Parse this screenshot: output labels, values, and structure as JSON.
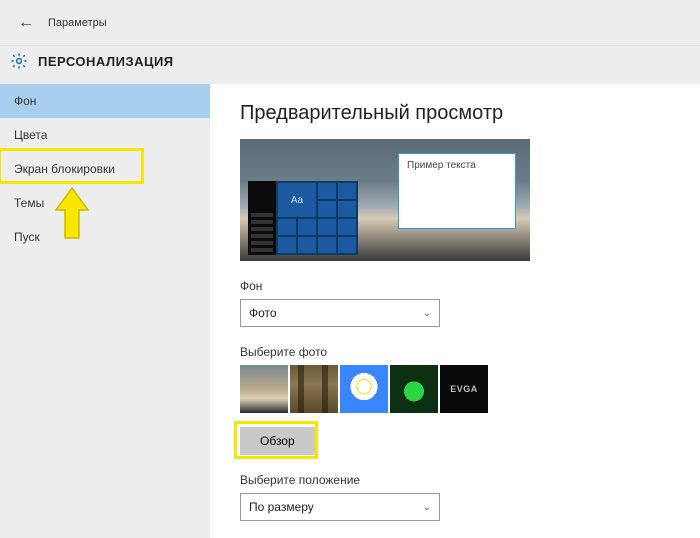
{
  "header": {
    "back_symbol": "←",
    "title": "Параметры"
  },
  "subheader": {
    "title": "ПЕРСОНАЛИЗАЦИЯ"
  },
  "sidebar": {
    "items": [
      {
        "label": "Фон"
      },
      {
        "label": "Цвета"
      },
      {
        "label": "Экран блокировки"
      },
      {
        "label": "Темы"
      },
      {
        "label": "Пуск"
      }
    ]
  },
  "content": {
    "preview_title": "Предварительный просмотр",
    "preview_note": "Пример текста",
    "tile_text": "Aa",
    "bg_label": "Фон",
    "bg_select_value": "Фото",
    "choose_photo_label": "Выберите фото",
    "thumbs": [
      "sunset",
      "forest",
      "daisy",
      "neon-green",
      "evga-logo"
    ],
    "evga_text": "EVGA",
    "browse_label": "Обзор",
    "position_label": "Выберите положение",
    "position_value": "По размеру"
  }
}
